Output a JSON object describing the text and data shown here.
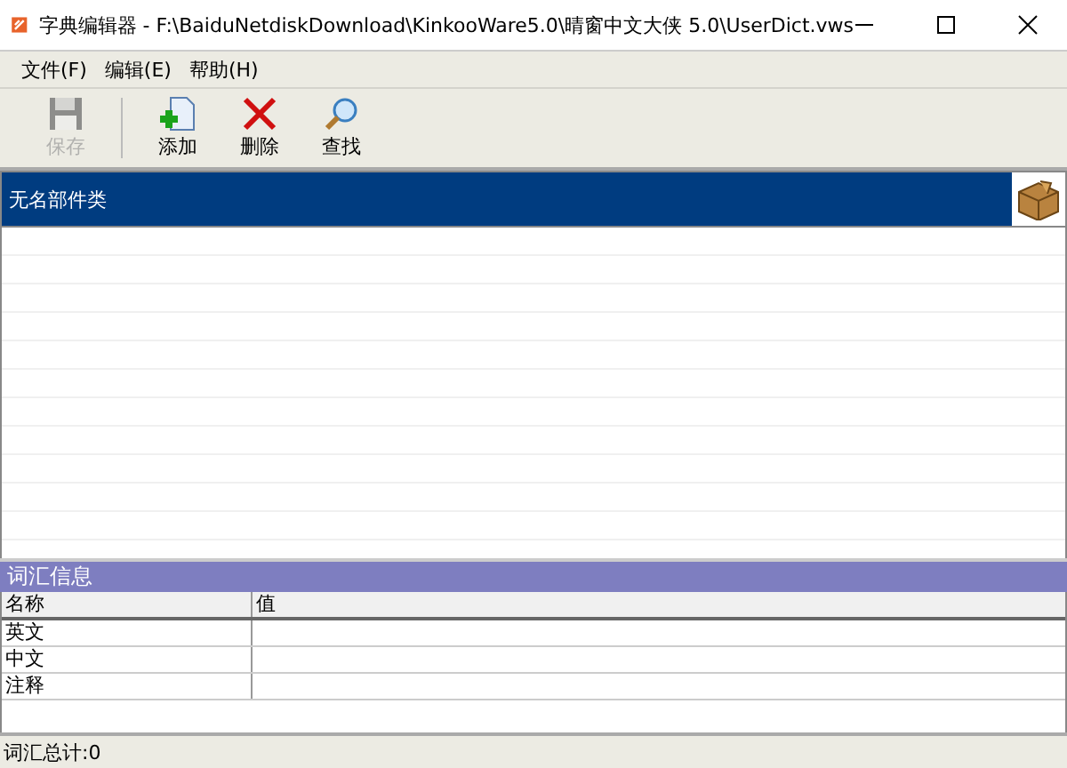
{
  "window": {
    "title": "字典编辑器 - F:\\BaiduNetdiskDownload\\KinkooWare5.0\\晴窗中文大侠 5.0\\UserDict.vws"
  },
  "menu": [
    "文件(F)",
    "编辑(E)",
    "帮助(H)"
  ],
  "toolbar": [
    {
      "kind": "save",
      "label": "保存",
      "disabled": true
    },
    {
      "kind": "add",
      "label": "添加",
      "disabled": false
    },
    {
      "kind": "delete",
      "label": "删除",
      "disabled": false
    },
    {
      "kind": "find",
      "label": "查找",
      "disabled": false
    }
  ],
  "list_header": {
    "title": "无名部件类"
  },
  "info": {
    "title": "词汇信息",
    "columns": [
      "名称",
      "值"
    ],
    "rows": [
      "英文",
      "中文",
      "注释"
    ]
  },
  "status_bar": "词汇总计:0"
}
